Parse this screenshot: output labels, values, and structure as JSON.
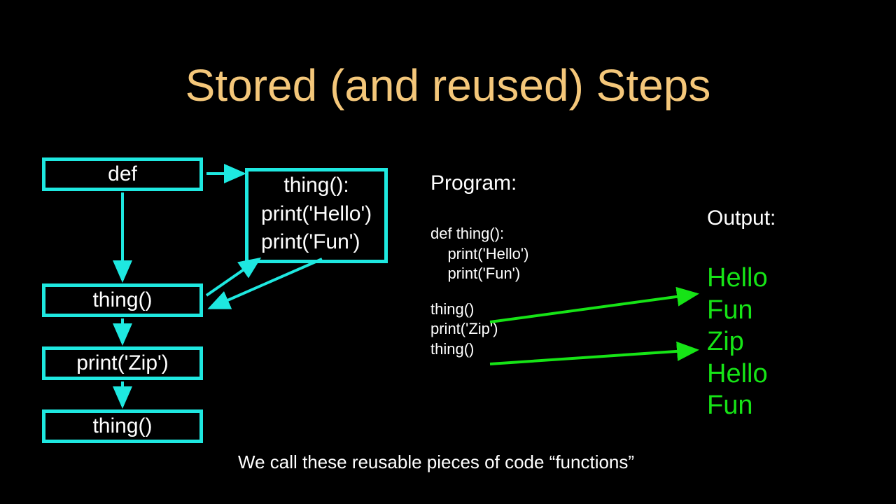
{
  "title": "Stored (and reused) Steps",
  "boxes": {
    "def": "def",
    "thing1": "thing()",
    "printzip": "print('Zip')",
    "thing2": "thing()"
  },
  "funcdef": {
    "line1": "thing():",
    "line2": "print('Hello')",
    "line3": "print('Fun')"
  },
  "program": {
    "label": "Program:",
    "line1": "def thing():",
    "line2": "    print('Hello')",
    "line3": "    print('Fun')",
    "line4": "",
    "line5": "thing()",
    "line6": "print('Zip')",
    "line7": "thing()"
  },
  "output": {
    "label": "Output:",
    "line1": "Hello",
    "line2": "Fun",
    "line3": "Zip",
    "line4": "Hello",
    "line5": "Fun"
  },
  "footer": "We call these reusable pieces of code “functions”",
  "colors": {
    "accent": "#1ee8e0",
    "title": "#f4c77a",
    "output": "#16e416"
  }
}
